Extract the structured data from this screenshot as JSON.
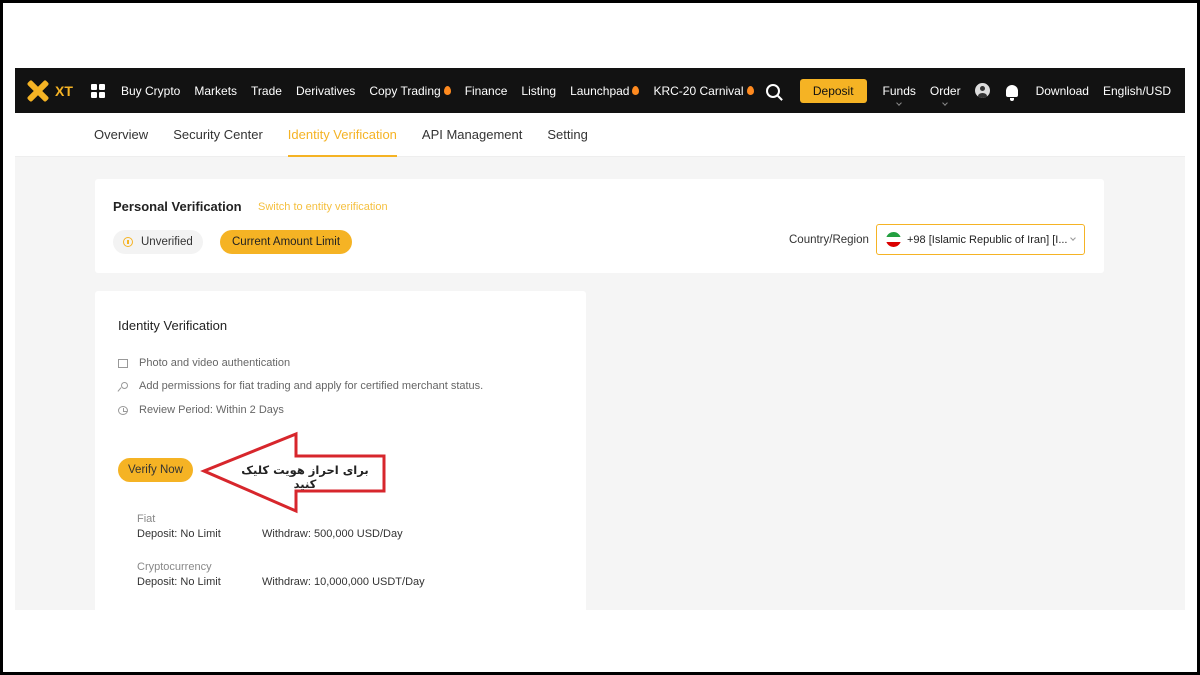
{
  "nav": {
    "logo_text": "XT",
    "items": [
      "Buy Crypto",
      "Markets",
      "Trade",
      "Derivatives",
      "Copy Trading",
      "Finance",
      "Listing",
      "Launchpad",
      "KRC-20 Carnival"
    ],
    "deposit_label": "Deposit",
    "funds_label": "Funds",
    "order_label": "Order",
    "download_label": "Download",
    "lang_label": "English/USD"
  },
  "tabs": [
    "Overview",
    "Security Center",
    "Identity Verification",
    "API Management",
    "Setting"
  ],
  "personal": {
    "title": "Personal Verification",
    "switch_link": "Switch to entity verification",
    "status": "Unverified",
    "limit_button": "Current Amount Limit",
    "country_label": "Country/Region",
    "country_value": "+98 [Islamic Republic of Iran] [I..."
  },
  "identity": {
    "title": "Identity Verification",
    "features": [
      "Photo and video authentication",
      "Add permissions for fiat trading and apply for certified merchant status.",
      "Review Period: Within 2 Days"
    ],
    "verify_button": "Verify Now",
    "fiat": {
      "label": "Fiat",
      "deposit": "Deposit: No Limit",
      "withdraw": "Withdraw: 500,000 USD/Day"
    },
    "crypto": {
      "label": "Cryptocurrency",
      "deposit": "Deposit: No Limit",
      "withdraw": "Withdraw: 10,000,000 USDT/Day"
    }
  },
  "annotation": {
    "text": "برای احراز هویت کلیک کنید",
    "color": "#d7262c"
  },
  "colors": {
    "accent": "#f5b324",
    "nav_bg": "#121212"
  }
}
